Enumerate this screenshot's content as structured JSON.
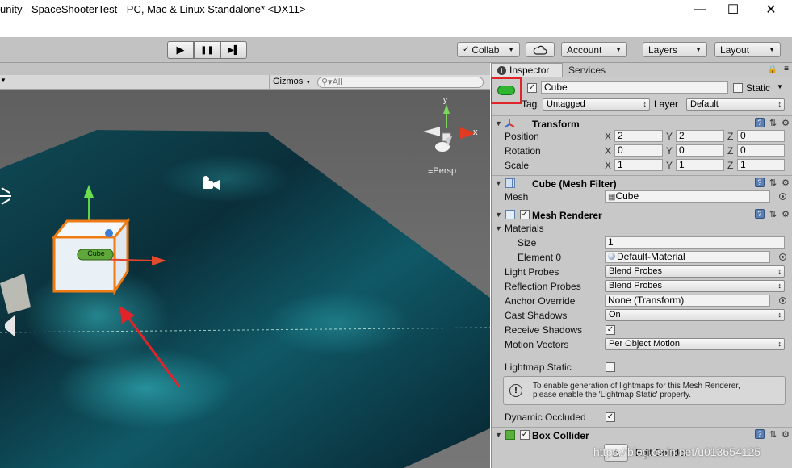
{
  "window": {
    "title": "unity - SpaceShooterTest - PC, Mac & Linux Standalone* <DX11>",
    "minimize": "—",
    "maximize": "☐",
    "close": "✕"
  },
  "toolbar": {
    "play": "▶",
    "pause": "❚❚",
    "step": "▶▌",
    "collab": "Collab",
    "cloud_icon": "cloud-icon",
    "account": "Account",
    "layers": "Layers",
    "layout": "Layout"
  },
  "scene": {
    "gizmos": "Gizmos",
    "search_placeholder": "All",
    "persp": "Persp",
    "axis_y": "y",
    "axis_x": "x",
    "cube_label": "Cube",
    "watermark": "https://blog.csdn.net/u013654125"
  },
  "inspector": {
    "tabs": [
      "Inspector",
      "Services"
    ],
    "object_name": "Cube",
    "static_label": "Static",
    "tag_label": "Tag",
    "tag_value": "Untagged",
    "layer_label": "Layer",
    "layer_value": "Default",
    "transform": {
      "title": "Transform",
      "rows": [
        {
          "label": "Position",
          "x": "2",
          "y": "2",
          "z": "0"
        },
        {
          "label": "Rotation",
          "x": "0",
          "y": "0",
          "z": "0"
        },
        {
          "label": "Scale",
          "x": "1",
          "y": "1",
          "z": "1"
        }
      ],
      "axis_x": "X",
      "axis_y": "Y",
      "axis_z": "Z"
    },
    "mesh_filter": {
      "title": "Cube (Mesh Filter)",
      "mesh_label": "Mesh",
      "mesh_value": "Cube"
    },
    "mesh_renderer": {
      "title": "Mesh Renderer",
      "materials_label": "Materials",
      "size_label": "Size",
      "size_value": "1",
      "element0_label": "Element 0",
      "element0_value": "Default-Material",
      "light_probes_label": "Light Probes",
      "light_probes_value": "Blend Probes",
      "reflection_probes_label": "Reflection Probes",
      "reflection_probes_value": "Blend Probes",
      "anchor_override_label": "Anchor Override",
      "anchor_override_value": "None (Transform)",
      "cast_shadows_label": "Cast Shadows",
      "cast_shadows_value": "On",
      "receive_shadows_label": "Receive Shadows",
      "motion_vectors_label": "Motion Vectors",
      "motion_vectors_value": "Per Object Motion",
      "lightmap_static_label": "Lightmap Static",
      "info_line1": "To enable generation of lightmaps for this Mesh Renderer,",
      "info_line2": "please enable the 'Lightmap Static' property.",
      "dynamic_occluded_label": "Dynamic Occluded"
    },
    "box_collider": {
      "title": "Box Collider",
      "edit_collider": "Edit Collider"
    }
  },
  "colors": {
    "highlight_red": "#e0242a",
    "icon_green": "#2fb52f",
    "selection_orange": "#f07a14"
  }
}
